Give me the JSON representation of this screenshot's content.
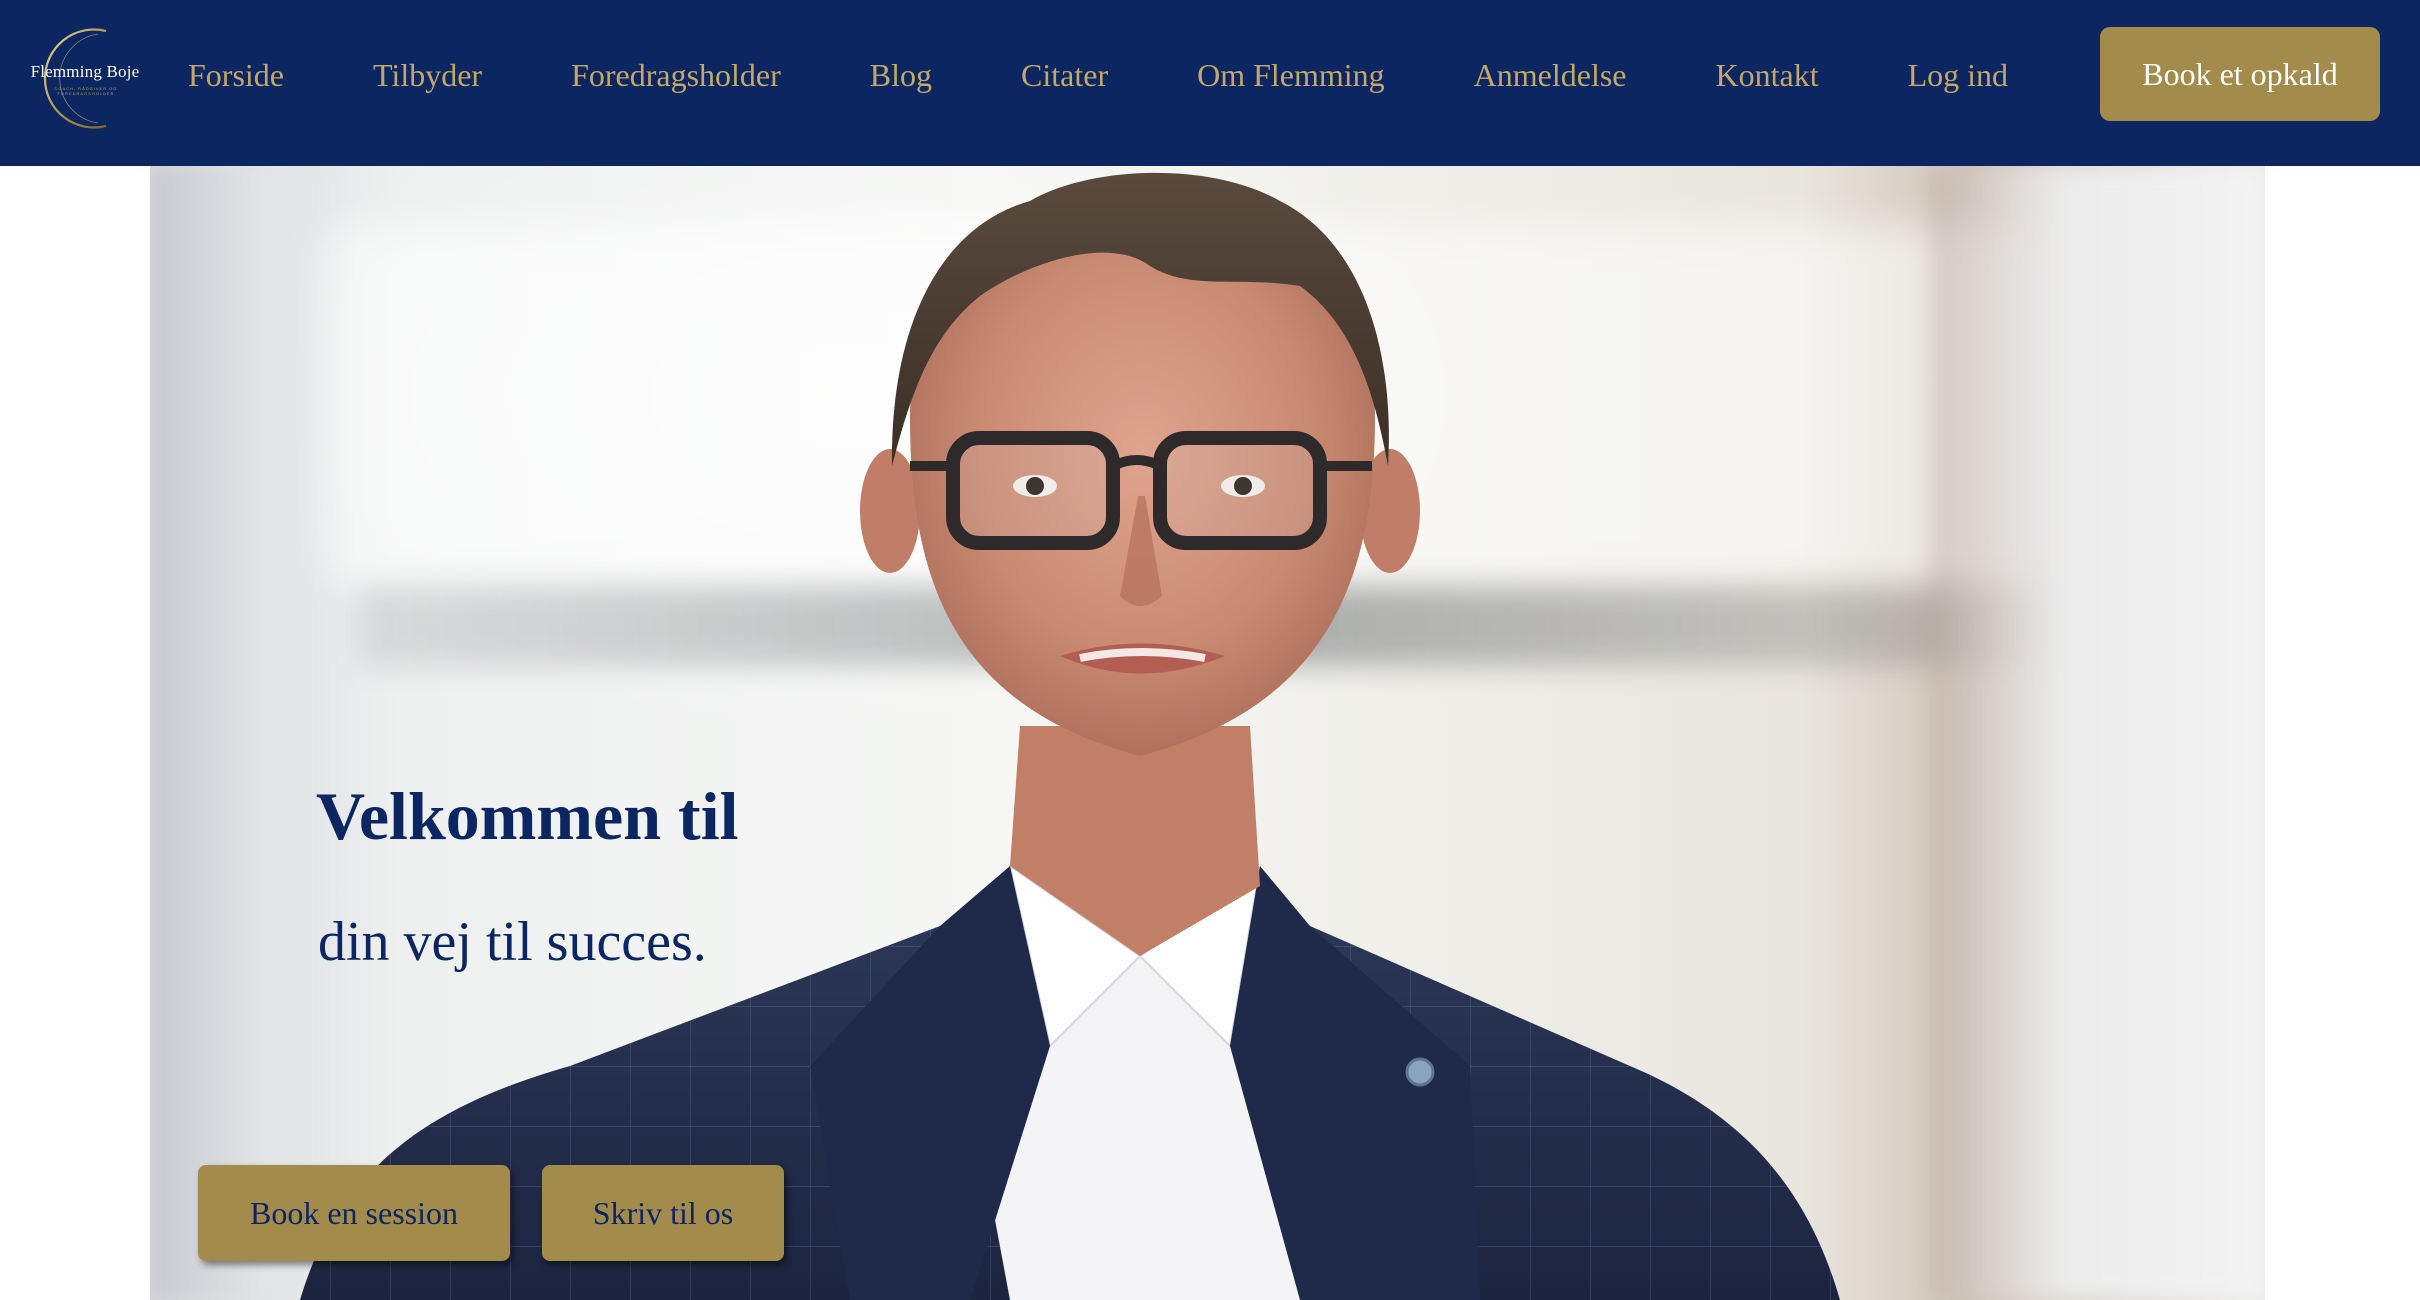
{
  "header": {
    "logo": {
      "name": "Flemming Boje",
      "tagline": "COACH, RÅDGIVER OG FOREDRAGSHOLDER"
    },
    "nav": [
      {
        "label": "Forside"
      },
      {
        "label": "Tilbyder"
      },
      {
        "label": "Foredragsholder"
      },
      {
        "label": "Blog"
      },
      {
        "label": "Citater"
      },
      {
        "label": "Om Flemming"
      },
      {
        "label": "Anmeldelse"
      },
      {
        "label": "Kontakt"
      },
      {
        "label": "Log ind"
      }
    ],
    "cta_label": "Book et opkald"
  },
  "hero": {
    "title": "Velkommen til",
    "subtitle": "din vej til succes.",
    "primary_button": "Book en session",
    "secondary_button": "Skriv til os"
  },
  "colors": {
    "navy": "#0b2660",
    "gold": "#a38b4c",
    "nav_text": "#c3a86a",
    "white": "#ffffff"
  }
}
